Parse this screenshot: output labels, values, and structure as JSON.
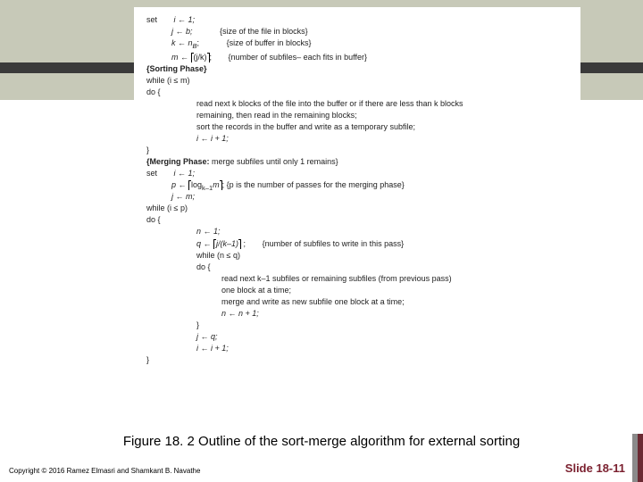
{
  "algo": {
    "l1a": "set",
    "l1b": "i ← 1;",
    "l2a": "j ← b;",
    "l2b": "{size of the file in blocks}",
    "l3a": "k ← n",
    "l3sub": "B",
    "l3c": ";",
    "l3d": "{size of buffer in blocks}",
    "l4a": "m ← ",
    "l4ceil": "(j/k)",
    "l4b": ";",
    "l4c": "{number of subfiles– each fits in buffer}",
    "l5": "{Sorting Phase}",
    "l6": "while (i ≤ m)",
    "l7": "do {",
    "l8": "read next k blocks of the file into the buffer or if there are less than k blocks",
    "l9": "remaining, then read in the remaining blocks;",
    "l10": "sort the records in the buffer and write as a temporary subfile;",
    "l11": "i ← i + 1;",
    "l12": "}",
    "l13a": "{Merging Phase:",
    "l13b": " merge subfiles until only 1 remains}",
    "l14": "set",
    "l14b": "i ← 1;",
    "l15a": "p ← ",
    "l15ceil1": "log",
    "l15sub": "k–1",
    "l15ceil2": "m",
    "l15b": "; {p is the number of passes for the merging phase}",
    "l16": "j ← m;",
    "l17": "while (i ≤ p)",
    "l18": "do {",
    "l19": "n ← 1;",
    "l20a": "q ← ",
    "l20ceil": " j/(k–1) ",
    "l20b": " ;",
    "l20c": "{number of subfiles to write in this pass}",
    "l21": "while (n ≤ q)",
    "l22": "do {",
    "l23": "read next k–1 subfiles or remaining subfiles (from previous pass)",
    "l24": "one block at a time;",
    "l25": "merge and write as new subfile one block at a time;",
    "l26": "n ← n + 1;",
    "l27": "}",
    "l28": "j ← q;",
    "l29": "i ← i + 1;",
    "l30": "}"
  },
  "caption": "Figure 18. 2 Outline of the sort-merge algorithm for external sorting",
  "copyright": "Copyright © 2016 Ramez Elmasri and Shamkant B. Navathe",
  "slide": "Slide 18-11"
}
